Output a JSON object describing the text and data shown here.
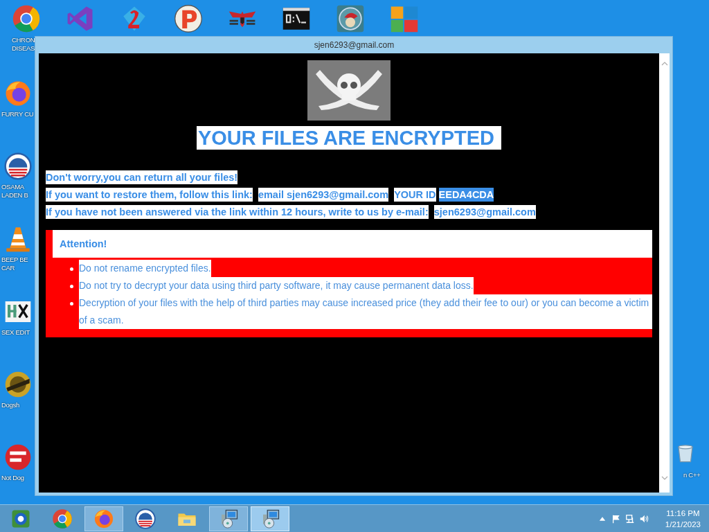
{
  "desktop_icons": [
    {
      "kind": "chrome",
      "label_lines": [
        "CHRON",
        "DISEAS"
      ]
    },
    {
      "kind": "vs"
    },
    {
      "kind": "gem"
    },
    {
      "kind": "ball"
    },
    {
      "kind": "eagle"
    },
    {
      "kind": "cmd"
    },
    {
      "kind": "globe"
    },
    {
      "kind": "tiles"
    },
    {
      "kind": "firefox",
      "label_lines": [
        "FURRY CU"
      ]
    },
    {
      "kind": "sunrise",
      "label_lines": [
        "OSAMA",
        "LADEN B"
      ]
    },
    {
      "kind": "cone",
      "label_lines": [
        "BEEP BE",
        "CAR"
      ]
    },
    {
      "kind": "hex",
      "label_lines": [
        "SEX EDIT"
      ]
    },
    {
      "kind": "gold",
      "label_lines": [
        "Dogsh"
      ]
    },
    {
      "kind": "devc",
      "label_lines": [
        "Not Dog"
      ]
    }
  ],
  "recycle_bin": {
    "label": "n C++"
  },
  "window": {
    "title": "sjen6293@gmail.com",
    "heading": "YOUR FILES ARE ENCRYPTED",
    "message_lines": [
      [
        {
          "text": "Don't worry,you can return all your files!",
          "selected": false
        }
      ],
      [
        {
          "text": "If you want to restore them, follow this link:",
          "selected": false
        },
        {
          "text": "email sjen6293@gmail.com",
          "selected": false
        },
        {
          "text": "YOUR ID",
          "selected": false
        },
        {
          "text": "EEDA4CDA",
          "selected": true
        }
      ],
      [
        {
          "text": "If you have not been answered via the link within 12 hours, write to us by e-mail:",
          "selected": false
        },
        {
          "text": "sjen6293@gmail.com",
          "selected": false
        }
      ]
    ],
    "attention": {
      "title": "Attention!",
      "items": [
        "Do not rename encrypted files.",
        "Do not try to decrypt your data using third party software, it may cause permanent data loss.",
        "Decryption of your files with the help of third parties may cause increased price (they add their fee to our) or you can become a victim of a scam."
      ]
    }
  },
  "taskbar": {
    "items": [
      {
        "kind": "orb",
        "open": false,
        "selected": false
      },
      {
        "kind": "chrome",
        "open": false,
        "selected": false
      },
      {
        "kind": "firefox",
        "open": true,
        "selected": false
      },
      {
        "kind": "sunrise",
        "open": false,
        "selected": false
      },
      {
        "kind": "folder",
        "open": false,
        "selected": false
      },
      {
        "kind": "installer",
        "open": true,
        "selected": false
      },
      {
        "kind": "installer",
        "open": true,
        "selected": true
      }
    ],
    "time": "11:16 PM",
    "date": "1/21/2023"
  }
}
